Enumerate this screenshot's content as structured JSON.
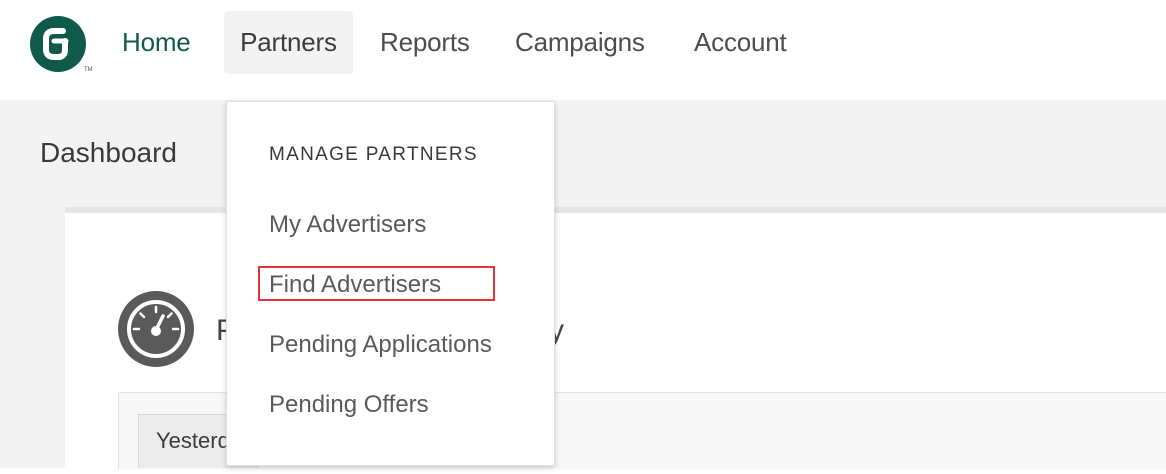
{
  "nav": {
    "logo": {
      "icon": "cj-logo-icon",
      "tm": "TM",
      "color": "#0f5a4a"
    },
    "items": [
      {
        "label": "Home",
        "active": true
      },
      {
        "label": "Partners",
        "open": true
      },
      {
        "label": "Reports"
      },
      {
        "label": "Campaigns"
      },
      {
        "label": "Account"
      }
    ]
  },
  "page": {
    "title": "Dashboard",
    "card": {
      "icon": "gauge-icon",
      "title_left_fragment": "P",
      "title_right_fragment": "y"
    },
    "filter": {
      "selected_value": "Yesterday"
    }
  },
  "dropdown": {
    "heading": "MANAGE PARTNERS",
    "items": [
      {
        "label": "My Advertisers"
      },
      {
        "label": "Find Advertisers",
        "highlighted": true
      },
      {
        "label": "Pending Applications"
      },
      {
        "label": "Pending Offers"
      }
    ],
    "highlight_color": "#e3343d"
  }
}
